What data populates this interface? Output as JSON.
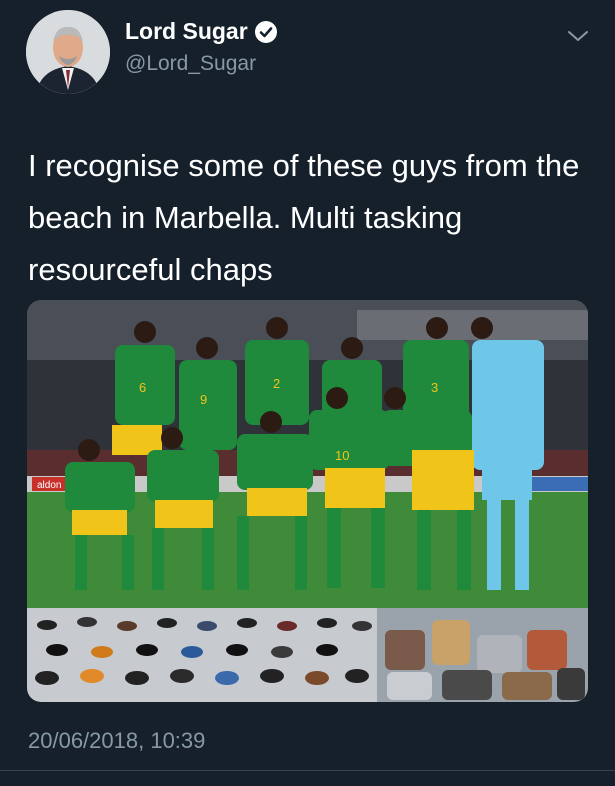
{
  "tweet": {
    "display_name": "Lord Sugar",
    "handle": "@Lord_Sugar",
    "verified": true,
    "text": "I recognise some of these guys from the beach in Marbella. Multi tasking resourceful chaps",
    "timestamp": "20/06/2018, 10:39"
  },
  "media": {
    "ad_board_text": "aldon",
    "team_photo_numbers": [
      "6",
      "9",
      "2",
      "3",
      "10"
    ]
  },
  "icons": {
    "verified": "verified-badge-icon",
    "menu": "chevron-down-icon"
  },
  "colors": {
    "background": "#15202b",
    "secondary_text": "#8899a6",
    "jersey_green": "#1f8a3c",
    "jersey_yellow": "#f0c419",
    "keeper_blue": "#6ec6e8"
  }
}
